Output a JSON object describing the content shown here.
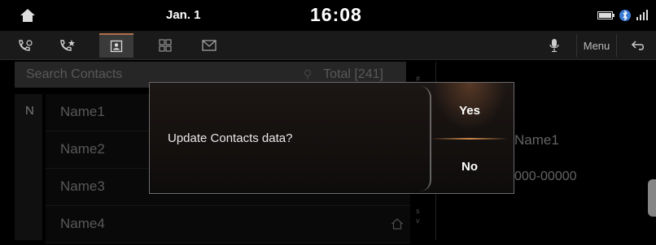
{
  "status": {
    "date": "Jan. 1",
    "time": "16:08",
    "icons": [
      "battery-icon",
      "bluetooth-icon",
      "signal-icon"
    ]
  },
  "tabs": [
    {
      "name": "call-history-icon",
      "active": false
    },
    {
      "name": "favorites-icon",
      "active": false
    },
    {
      "name": "contacts-icon",
      "active": true
    },
    {
      "name": "keypad-icon",
      "active": false
    },
    {
      "name": "messages-icon",
      "active": false
    }
  ],
  "toolbar": {
    "menu_label": "Menu"
  },
  "search": {
    "placeholder": "Search Contacts",
    "total": "Total [241]"
  },
  "index": {
    "current_letter": "N"
  },
  "contacts": [
    "Name1",
    "Name2",
    "Name3",
    "Name4"
  ],
  "scroll_letters_top": "#",
  "scroll_letters_bottom": [
    "s",
    "v"
  ],
  "detail": {
    "name": "Name1",
    "number": "000-00000"
  },
  "dialog": {
    "message": "Update Contacts data?",
    "yes_label": "Yes",
    "no_label": "No"
  },
  "colors": {
    "accent": "#d08a4a",
    "background": "#000000",
    "search_bg": "#3b3b3b"
  }
}
